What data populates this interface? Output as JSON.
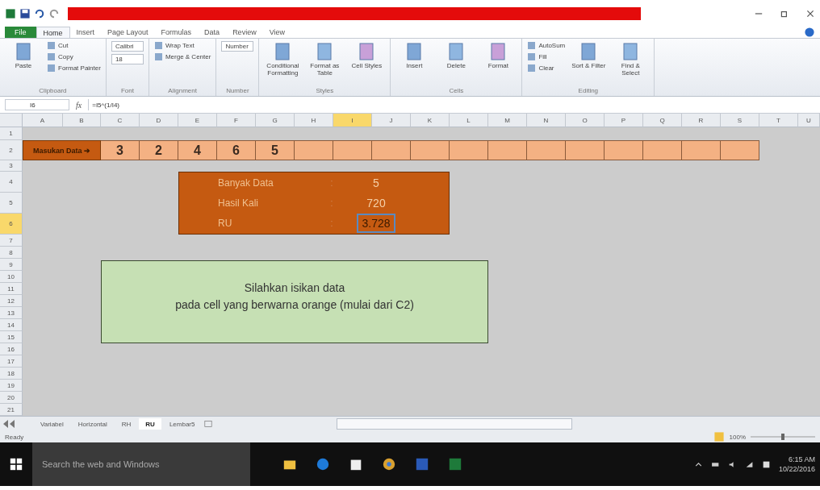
{
  "tabs": [
    {
      "label": "File",
      "selected": false,
      "kind": "file"
    },
    {
      "label": "Home",
      "selected": true,
      "kind": "tab"
    },
    {
      "label": "Insert",
      "selected": false,
      "kind": "tab"
    },
    {
      "label": "Page Layout",
      "selected": false,
      "kind": "tab"
    },
    {
      "label": "Formulas",
      "selected": false,
      "kind": "tab"
    },
    {
      "label": "Data",
      "selected": false,
      "kind": "tab"
    },
    {
      "label": "Review",
      "selected": false,
      "kind": "tab"
    },
    {
      "label": "View",
      "selected": false,
      "kind": "tab"
    }
  ],
  "ribbon": [
    {
      "label": "Clipboard",
      "items": [
        {
          "label": "Paste",
          "kind": "large"
        },
        {
          "label": "Cut",
          "kind": "small"
        },
        {
          "label": "Copy",
          "kind": "small"
        },
        {
          "label": "Format Painter",
          "kind": "small"
        }
      ]
    },
    {
      "label": "Font",
      "items": [
        {
          "label": "Calibri",
          "kind": "field"
        },
        {
          "label": "18",
          "kind": "field"
        }
      ]
    },
    {
      "label": "Alignment",
      "items": [
        {
          "label": "Wrap Text",
          "kind": "small"
        },
        {
          "label": "Merge & Center",
          "kind": "small"
        }
      ]
    },
    {
      "label": "Number",
      "items": [
        {
          "label": "Number",
          "kind": "field"
        }
      ]
    },
    {
      "label": "Styles",
      "items": [
        {
          "label": "Conditional Formatting",
          "kind": "large"
        },
        {
          "label": "Format as Table",
          "kind": "large"
        },
        {
          "label": "Cell Styles",
          "kind": "large"
        }
      ]
    },
    {
      "label": "Cells",
      "items": [
        {
          "label": "Insert",
          "kind": "large"
        },
        {
          "label": "Delete",
          "kind": "large"
        },
        {
          "label": "Format",
          "kind": "large"
        }
      ]
    },
    {
      "label": "Editing",
      "items": [
        {
          "label": "AutoSum",
          "kind": "small"
        },
        {
          "label": "Fill",
          "kind": "small"
        },
        {
          "label": "Clear",
          "kind": "small"
        },
        {
          "label": "Sort & Filter",
          "kind": "large"
        },
        {
          "label": "Find & Select",
          "kind": "large"
        }
      ]
    }
  ],
  "formula_bar": {
    "name_box": "I6",
    "fx_label": "fx",
    "formula": "=I5^(1/I4)"
  },
  "columns": [
    {
      "label": "A",
      "selected": false
    },
    {
      "label": "B",
      "selected": false
    },
    {
      "label": "C",
      "selected": false
    },
    {
      "label": "D",
      "selected": false
    },
    {
      "label": "E",
      "selected": false
    },
    {
      "label": "F",
      "selected": false
    },
    {
      "label": "G",
      "selected": false
    },
    {
      "label": "H",
      "selected": false
    },
    {
      "label": "I",
      "selected": true
    },
    {
      "label": "J",
      "selected": false
    },
    {
      "label": "K",
      "selected": false
    },
    {
      "label": "L",
      "selected": false
    },
    {
      "label": "M",
      "selected": false
    },
    {
      "label": "N",
      "selected": false
    },
    {
      "label": "O",
      "selected": false
    },
    {
      "label": "P",
      "selected": false
    },
    {
      "label": "Q",
      "selected": false
    },
    {
      "label": "R",
      "selected": false
    },
    {
      "label": "S",
      "selected": false
    },
    {
      "label": "T",
      "selected": false
    },
    {
      "label": "U",
      "selected": false
    }
  ],
  "rows": [
    {
      "label": "1",
      "selected": false
    },
    {
      "label": "2",
      "selected": false
    },
    {
      "label": "3",
      "selected": false
    },
    {
      "label": "4",
      "selected": false
    },
    {
      "label": "5",
      "selected": false
    },
    {
      "label": "6",
      "selected": true
    },
    {
      "label": "7",
      "selected": false
    },
    {
      "label": "8",
      "selected": false
    },
    {
      "label": "9",
      "selected": false
    },
    {
      "label": "10",
      "selected": false
    },
    {
      "label": "11",
      "selected": false
    },
    {
      "label": "12",
      "selected": false
    },
    {
      "label": "13",
      "selected": false
    },
    {
      "label": "14",
      "selected": false
    },
    {
      "label": "15",
      "selected": false
    },
    {
      "label": "16",
      "selected": false
    },
    {
      "label": "17",
      "selected": false
    },
    {
      "label": "18",
      "selected": false
    },
    {
      "label": "19",
      "selected": false
    },
    {
      "label": "20",
      "selected": false
    },
    {
      "label": "21",
      "selected": false
    }
  ],
  "data_row": {
    "label": "Masukan Data ➔",
    "values": [
      "3",
      "2",
      "4",
      "6",
      "5"
    ]
  },
  "summary": [
    {
      "label": "Banyak Data",
      "separator": ":",
      "value": "5",
      "selected": false
    },
    {
      "label": "Hasil Kali",
      "separator": ":",
      "value": "720",
      "selected": false
    },
    {
      "label": "RU",
      "separator": ":",
      "value": "3.728",
      "selected": true
    }
  ],
  "note": {
    "lines": [
      "Silahkan isikan data",
      "pada cell yang berwarna orange (mulai dari C2)"
    ]
  },
  "sheet_tabs": [
    {
      "label": "Variabel",
      "selected": false
    },
    {
      "label": "Horizontal",
      "selected": false
    },
    {
      "label": "RH",
      "selected": false
    },
    {
      "label": "RU",
      "selected": true
    },
    {
      "label": "Lembar5",
      "selected": false
    }
  ],
  "status_bar": {
    "status": "Ready",
    "zoom": "100%",
    "zoom_slider": {
      "level": 0.5
    }
  },
  "taskbar": {
    "search_placeholder": "Search the web and Windows",
    "time": "6:15 AM",
    "date": "10/22/2016"
  }
}
